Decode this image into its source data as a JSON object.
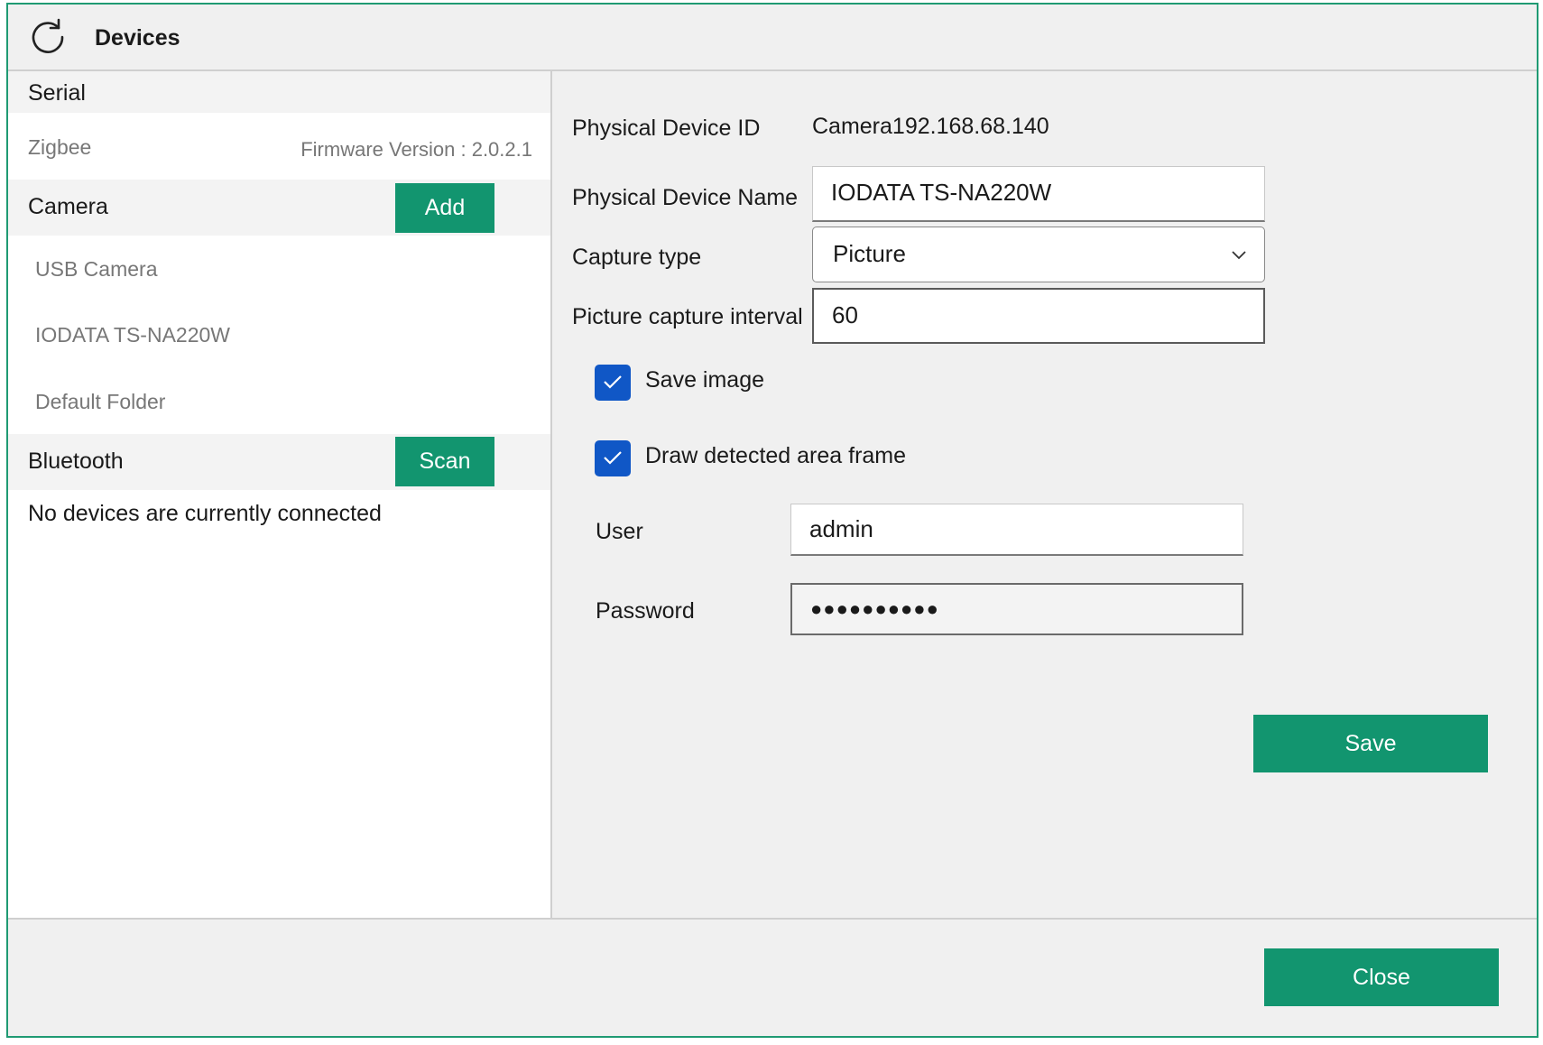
{
  "window": {
    "title": "Devices",
    "accent": "#12956f",
    "checkbox_color": "#1057c6"
  },
  "left": {
    "serial": {
      "header": "Serial",
      "items": [
        {
          "label": "Zigbee",
          "firmware": "Firmware Version : 2.0.2.1"
        }
      ]
    },
    "camera": {
      "header": "Camera",
      "add_button": "Add",
      "items": [
        {
          "label": "USB Camera"
        },
        {
          "label": "IODATA TS-NA220W"
        },
        {
          "label": "Default Folder"
        }
      ]
    },
    "bluetooth": {
      "header": "Bluetooth",
      "scan_button": "Scan",
      "empty_message": "No devices are currently connected"
    }
  },
  "form": {
    "device_id_label": "Physical Device ID",
    "device_id_value": "Camera192.168.68.140",
    "device_name_label": "Physical Device Name",
    "device_name_value": "IODATA TS-NA220W",
    "capture_type_label": "Capture type",
    "capture_type_value": "Picture",
    "interval_label": "Picture capture interval",
    "interval_value": "60",
    "save_image_label": "Save image",
    "save_image_checked": true,
    "draw_frame_label": "Draw detected area frame",
    "draw_frame_checked": true,
    "user_label": "User",
    "user_value": "admin",
    "password_label": "Password",
    "password_value": "●●●●●●●●●●",
    "save_button": "Save"
  },
  "footer": {
    "close_button": "Close"
  }
}
